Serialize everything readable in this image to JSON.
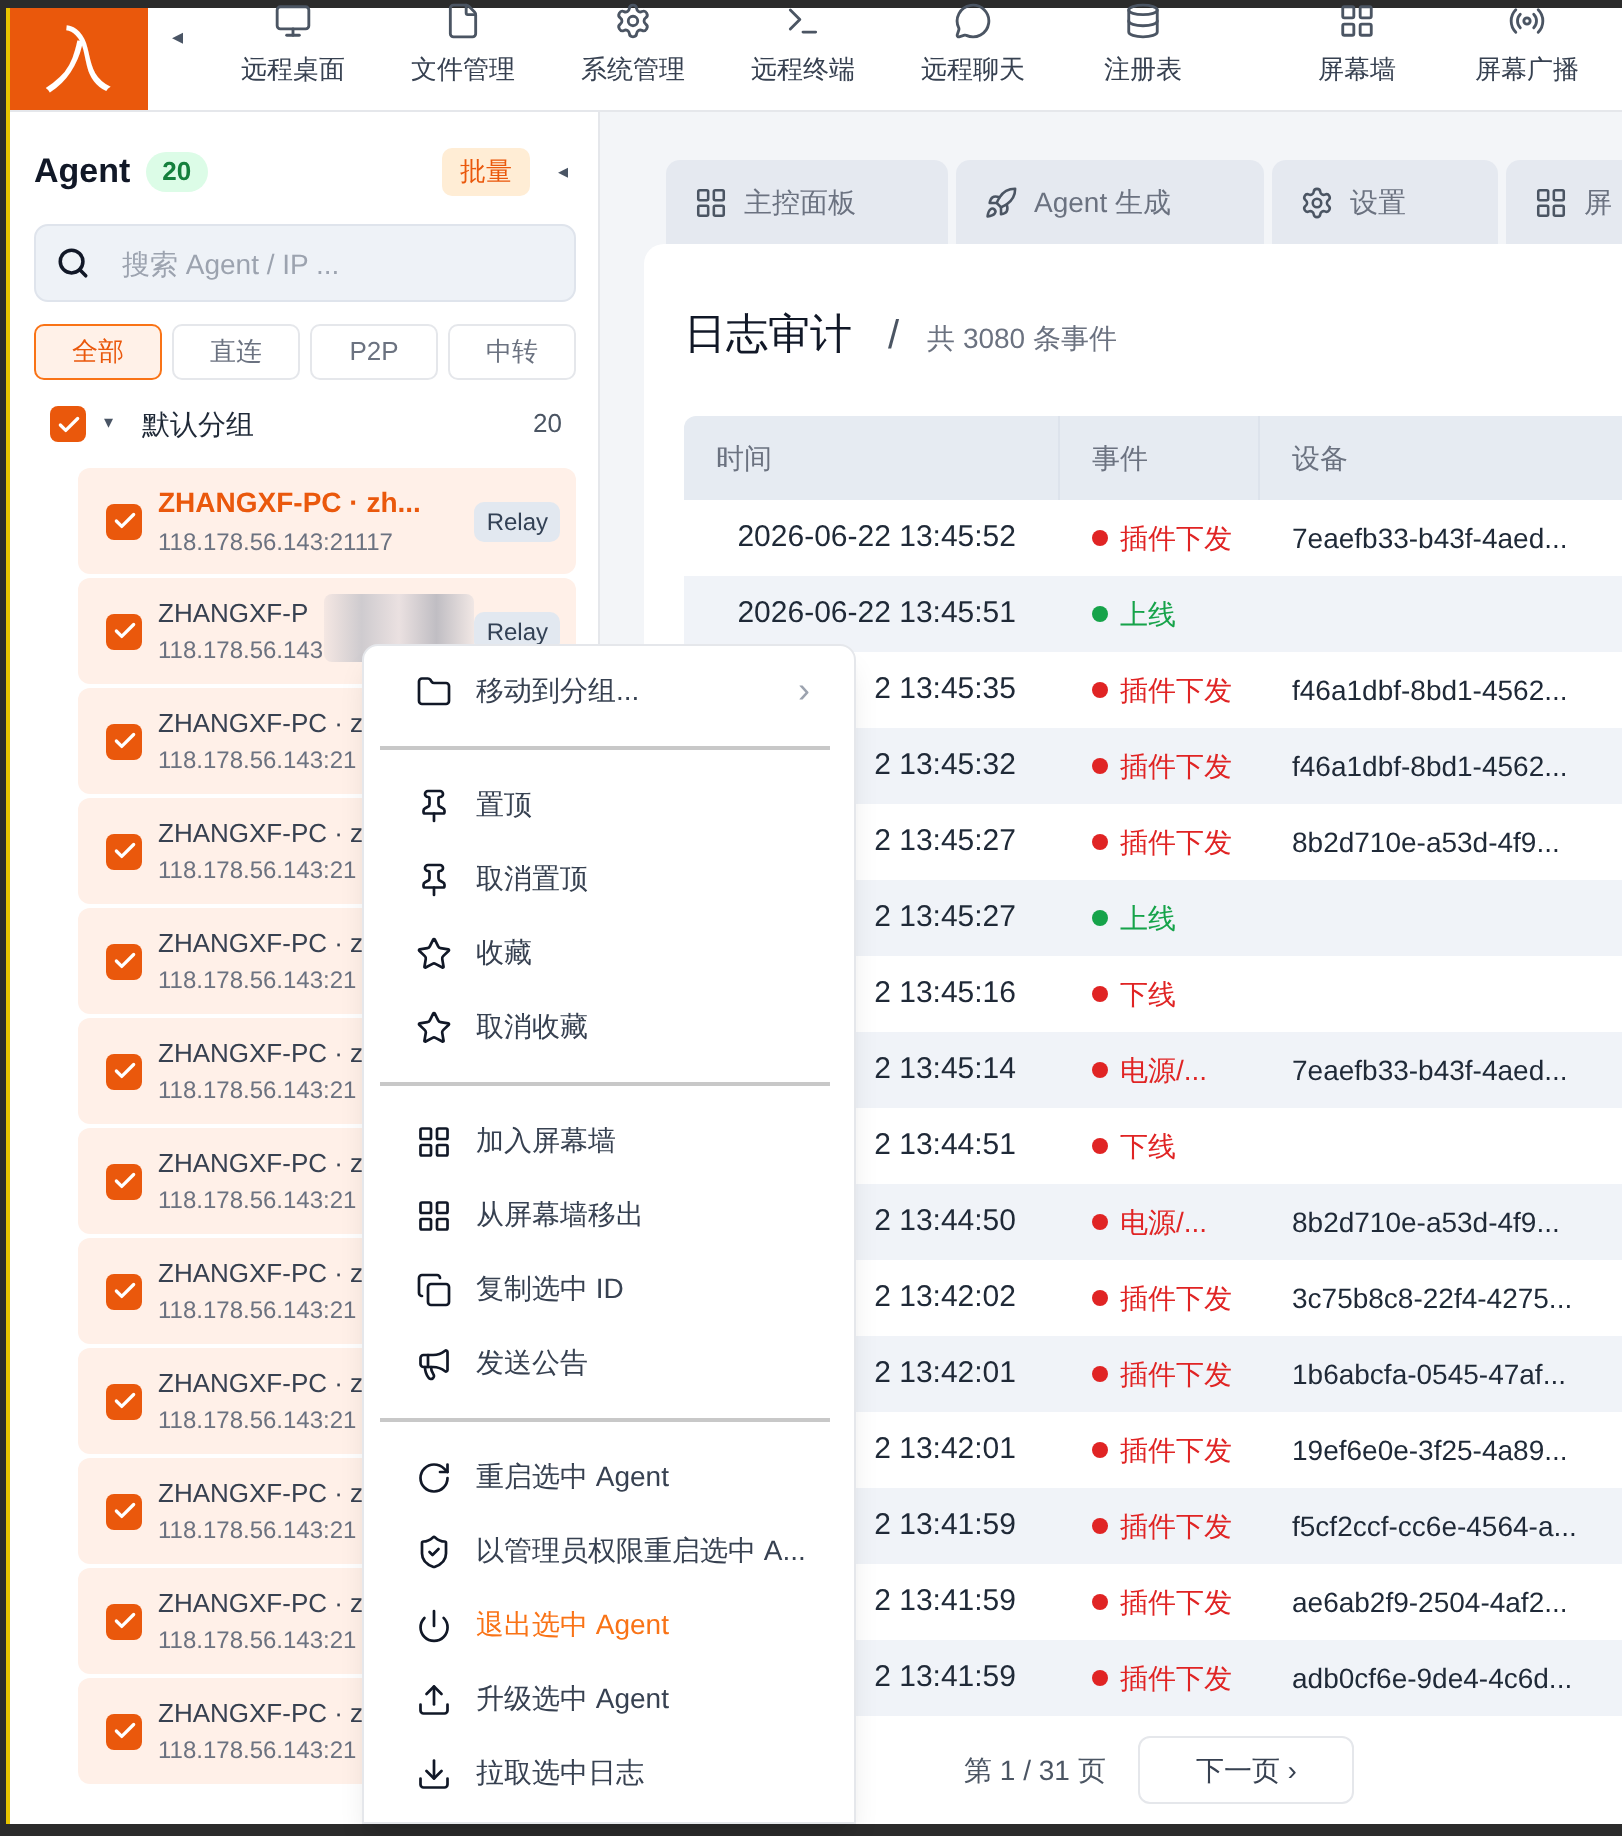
{
  "logo": "入",
  "nav_toggle": "◂",
  "nav": [
    {
      "label": "远程桌面",
      "kind": "monitor"
    },
    {
      "label": "文件管理",
      "kind": "file"
    },
    {
      "label": "系统管理",
      "kind": "gear"
    },
    {
      "label": "远程终端",
      "kind": "terminal"
    },
    {
      "label": "远程聊天",
      "kind": "chat"
    },
    {
      "label": "注册表",
      "kind": "database"
    },
    {
      "label": "屏幕墙",
      "kind": "grid"
    },
    {
      "label": "屏幕广播",
      "kind": "broadcast"
    }
  ],
  "sidebar": {
    "title": "Agent",
    "count": "20",
    "batch": "批量",
    "collapse": "◂",
    "search": {
      "placeholder": "搜索 Agent / IP ..."
    },
    "filters": [
      {
        "label": "全部",
        "selected": true
      },
      {
        "label": "直连",
        "selected": false
      },
      {
        "label": "P2P",
        "selected": false
      },
      {
        "label": "中转",
        "selected": false
      }
    ],
    "group": {
      "name": "默认分组",
      "caret": "▾",
      "count": "20",
      "checked": true
    },
    "agents": [
      {
        "name": "ZHANGXF-PC · zh...",
        "ip": "118.178.56.143:21117",
        "badge": "Relay",
        "checked": true,
        "selected": true,
        "redacted": false
      },
      {
        "name": "ZHANGXF-P",
        "ip": "118.178.56.143",
        "badge": "Relay",
        "checked": true,
        "selected": false,
        "redacted": true
      },
      {
        "name": "ZHANGXF-PC · z",
        "ip": "118.178.56.143:21",
        "checked": true,
        "selected": false,
        "redacted": false
      },
      {
        "name": "ZHANGXF-PC · z",
        "ip": "118.178.56.143:21",
        "checked": true,
        "selected": false,
        "redacted": false
      },
      {
        "name": "ZHANGXF-PC · z",
        "ip": "118.178.56.143:21",
        "checked": true,
        "selected": false,
        "redacted": false
      },
      {
        "name": "ZHANGXF-PC · z",
        "ip": "118.178.56.143:21",
        "checked": true,
        "selected": false,
        "redacted": false
      },
      {
        "name": "ZHANGXF-PC · z",
        "ip": "118.178.56.143:21",
        "checked": true,
        "selected": false,
        "redacted": false
      },
      {
        "name": "ZHANGXF-PC · z",
        "ip": "118.178.56.143:21",
        "checked": true,
        "selected": false,
        "redacted": false
      },
      {
        "name": "ZHANGXF-PC · z",
        "ip": "118.178.56.143:21",
        "checked": true,
        "selected": false,
        "redacted": false
      },
      {
        "name": "ZHANGXF-PC · z",
        "ip": "118.178.56.143:21",
        "checked": true,
        "selected": false,
        "redacted": false
      },
      {
        "name": "ZHANGXF-PC · z",
        "ip": "118.178.56.143:21",
        "checked": true,
        "selected": false,
        "redacted": false
      },
      {
        "name": "ZHANGXF-PC · z",
        "ip": "118.178.56.143:21",
        "checked": true,
        "selected": false,
        "redacted": false
      }
    ]
  },
  "tabs": [
    {
      "label": "主控面板",
      "kind": "grid",
      "selected": false
    },
    {
      "label": "Agent 生成",
      "kind": "rocket",
      "selected": false
    },
    {
      "label": "设置",
      "kind": "gear",
      "selected": false
    },
    {
      "label": "屏",
      "kind": "grid",
      "selected": false
    }
  ],
  "page": {
    "title": "日志审计",
    "separator": "/",
    "subtitle": "共 3080 条事件"
  },
  "table": {
    "columns": [
      "时间",
      "事件",
      "设备"
    ],
    "rows": [
      {
        "time": "2026-06-22 13:45:52",
        "event": "插件下发",
        "color": "#e02424",
        "device": "7eaefb33-b43f-4aed..."
      },
      {
        "time": "2026-06-22 13:45:51",
        "event": "上线",
        "color": "#16a34a"
      },
      {
        "time": "2 13:45:35",
        "event": "插件下发",
        "color": "#e02424",
        "device": "f46a1dbf-8bd1-4562..."
      },
      {
        "time": "2 13:45:32",
        "event": "插件下发",
        "color": "#e02424",
        "device": "f46a1dbf-8bd1-4562..."
      },
      {
        "time": "2 13:45:27",
        "event": "插件下发",
        "color": "#e02424",
        "device": "8b2d710e-a53d-4f9..."
      },
      {
        "time": "2 13:45:27",
        "event": "上线",
        "color": "#16a34a"
      },
      {
        "time": "2 13:45:16",
        "event": "下线",
        "color": "#e02424"
      },
      {
        "time": "2 13:45:14",
        "event": "电源/...",
        "color": "#e02424",
        "device": "7eaefb33-b43f-4aed..."
      },
      {
        "time": "2 13:44:51",
        "event": "下线",
        "color": "#e02424"
      },
      {
        "time": "2 13:44:50",
        "event": "电源/...",
        "color": "#e02424",
        "device": "8b2d710e-a53d-4f9..."
      },
      {
        "time": "2 13:42:02",
        "event": "插件下发",
        "color": "#e02424",
        "device": "3c75b8c8-22f4-4275..."
      },
      {
        "time": "2 13:42:01",
        "event": "插件下发",
        "color": "#e02424",
        "device": "1b6abcfa-0545-47af..."
      },
      {
        "time": "2 13:42:01",
        "event": "插件下发",
        "color": "#e02424",
        "device": "19ef6e0e-3f25-4a89..."
      },
      {
        "time": "2 13:41:59",
        "event": "插件下发",
        "color": "#e02424",
        "device": "f5cf2ccf-cc6e-4564-a..."
      },
      {
        "time": "2 13:41:59",
        "event": "插件下发",
        "color": "#e02424",
        "device": "ae6ab2f9-2504-4af2..."
      },
      {
        "time": "2 13:41:59",
        "event": "插件下发",
        "color": "#e02424",
        "device": "adb0cf6e-9de4-4c6d..."
      }
    ]
  },
  "pagination": {
    "page": "第 1 / 31 页",
    "next": "下一页 ›"
  },
  "context_menu": {
    "sections": [
      [
        {
          "label": "移动到分组...",
          "kind": "folder",
          "submenu": "›",
          "danger": false
        }
      ],
      [
        {
          "label": "置顶",
          "kind": "pin",
          "danger": false
        },
        {
          "label": "取消置顶",
          "kind": "pin",
          "danger": false
        },
        {
          "label": "收藏",
          "kind": "star",
          "danger": false
        },
        {
          "label": "取消收藏",
          "kind": "star",
          "danger": false
        }
      ],
      [
        {
          "label": "加入屏幕墙",
          "kind": "grid",
          "danger": false
        },
        {
          "label": "从屏幕墙移出",
          "kind": "grid",
          "danger": false
        },
        {
          "label": "复制选中 ID",
          "kind": "copy",
          "danger": false
        },
        {
          "label": "发送公告",
          "kind": "megaphone",
          "danger": false
        }
      ],
      [
        {
          "label": "重启选中 Agent",
          "kind": "rotate",
          "danger": false
        },
        {
          "label": "以管理员权限重启选中 A...",
          "kind": "shield",
          "danger": false
        },
        {
          "label": "退出选中 Agent",
          "kind": "power",
          "danger": true
        },
        {
          "label": "升级选中 Agent",
          "kind": "upload",
          "danger": false
        },
        {
          "label": "拉取选中日志",
          "kind": "download",
          "danger": false
        }
      ]
    ]
  }
}
